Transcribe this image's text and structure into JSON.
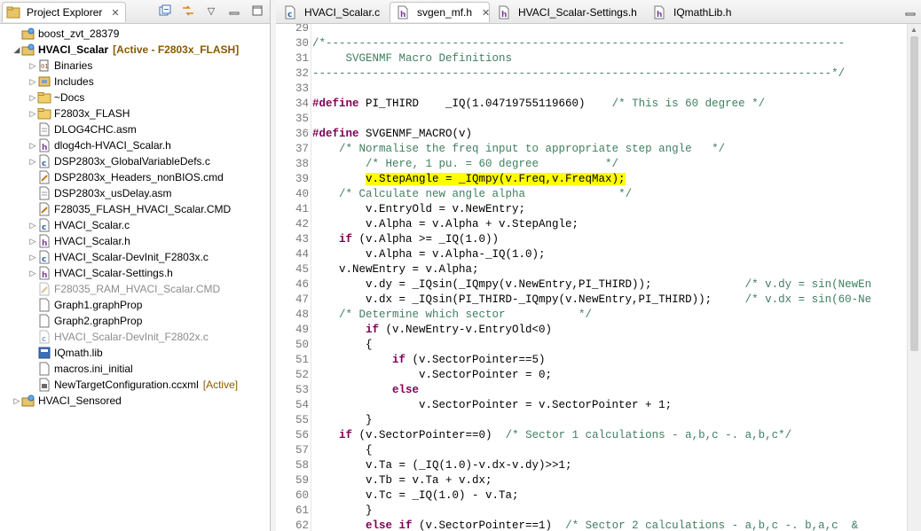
{
  "project_explorer": {
    "tab_label": "Project Explorer",
    "tools": [
      "collapse-all-icon",
      "link-editor-icon",
      "view-menu-icon",
      "minimize-icon",
      "maximize-icon"
    ],
    "items": [
      {
        "label": "boost_zvt_28379",
        "decoration": "",
        "level": 0,
        "twisty": "",
        "icon": "project-icon",
        "greyed": false,
        "bold": false
      },
      {
        "label": "HVACI_Scalar",
        "decoration": "[Active - F2803x_FLASH]",
        "level": 0,
        "twisty": "expanded",
        "icon": "project-icon",
        "greyed": false,
        "bold": true
      },
      {
        "label": "Binaries",
        "decoration": "",
        "level": 1,
        "twisty": "collapsed",
        "icon": "binaries-icon",
        "greyed": false,
        "bold": false
      },
      {
        "label": "Includes",
        "decoration": "",
        "level": 1,
        "twisty": "collapsed",
        "icon": "includes-icon",
        "greyed": false,
        "bold": false
      },
      {
        "label": "~Docs",
        "decoration": "",
        "level": 1,
        "twisty": "collapsed",
        "icon": "folder-icon",
        "greyed": false,
        "bold": false
      },
      {
        "label": "F2803x_FLASH",
        "decoration": "",
        "level": 1,
        "twisty": "collapsed",
        "icon": "folder-icon",
        "greyed": false,
        "bold": false
      },
      {
        "label": "DLOG4CHC.asm",
        "decoration": "",
        "level": 1,
        "twisty": "",
        "icon": "asm-file-icon",
        "greyed": false,
        "bold": false
      },
      {
        "label": "dlog4ch-HVACI_Scalar.h",
        "decoration": "",
        "level": 1,
        "twisty": "collapsed",
        "icon": "header-file-icon",
        "greyed": false,
        "bold": false
      },
      {
        "label": "DSP2803x_GlobalVariableDefs.c",
        "decoration": "",
        "level": 1,
        "twisty": "collapsed",
        "icon": "c-file-icon",
        "greyed": false,
        "bold": false
      },
      {
        "label": "DSP2803x_Headers_nonBIOS.cmd",
        "decoration": "",
        "level": 1,
        "twisty": "",
        "icon": "cmd-file-icon",
        "greyed": false,
        "bold": false
      },
      {
        "label": "DSP2803x_usDelay.asm",
        "decoration": "",
        "level": 1,
        "twisty": "",
        "icon": "asm-file-icon",
        "greyed": false,
        "bold": false
      },
      {
        "label": "F28035_FLASH_HVACI_Scalar.CMD",
        "decoration": "",
        "level": 1,
        "twisty": "",
        "icon": "cmd-file-icon",
        "greyed": false,
        "bold": false
      },
      {
        "label": "HVACI_Scalar.c",
        "decoration": "",
        "level": 1,
        "twisty": "collapsed",
        "icon": "c-file-icon",
        "greyed": false,
        "bold": false
      },
      {
        "label": "HVACI_Scalar.h",
        "decoration": "",
        "level": 1,
        "twisty": "collapsed",
        "icon": "header-file-icon",
        "greyed": false,
        "bold": false
      },
      {
        "label": "HVACI_Scalar-DevInit_F2803x.c",
        "decoration": "",
        "level": 1,
        "twisty": "collapsed",
        "icon": "c-file-icon",
        "greyed": false,
        "bold": false
      },
      {
        "label": "HVACI_Scalar-Settings.h",
        "decoration": "",
        "level": 1,
        "twisty": "collapsed",
        "icon": "header-file-icon",
        "greyed": false,
        "bold": false
      },
      {
        "label": "F28035_RAM_HVACI_Scalar.CMD",
        "decoration": "",
        "level": 1,
        "twisty": "",
        "icon": "cmd-file-icon",
        "greyed": true,
        "bold": false
      },
      {
        "label": "Graph1.graphProp",
        "decoration": "",
        "level": 1,
        "twisty": "",
        "icon": "file-icon",
        "greyed": false,
        "bold": false
      },
      {
        "label": "Graph2.graphProp",
        "decoration": "",
        "level": 1,
        "twisty": "",
        "icon": "file-icon",
        "greyed": false,
        "bold": false
      },
      {
        "label": "HVACI_Scalar-DevInit_F2802x.c",
        "decoration": "",
        "level": 1,
        "twisty": "",
        "icon": "c-file-icon",
        "greyed": true,
        "bold": false
      },
      {
        "label": "IQmath.lib",
        "decoration": "",
        "level": 1,
        "twisty": "",
        "icon": "library-icon",
        "greyed": false,
        "bold": false
      },
      {
        "label": "macros.ini_initial",
        "decoration": "",
        "level": 1,
        "twisty": "",
        "icon": "file-icon",
        "greyed": false,
        "bold": false
      },
      {
        "label": "NewTargetConfiguration.ccxml",
        "decoration": "[Active]",
        "level": 1,
        "twisty": "",
        "icon": "ccxml-file-icon",
        "greyed": false,
        "bold": false
      },
      {
        "label": "HVACI_Sensored",
        "decoration": "",
        "level": 0,
        "twisty": "collapsed",
        "icon": "project-icon",
        "greyed": false,
        "bold": false
      }
    ]
  },
  "editor_tabs": [
    {
      "label": "HVACI_Scalar.c",
      "icon": "c-file-icon",
      "active": false
    },
    {
      "label": "svgen_mf.h",
      "icon": "header-file-icon",
      "active": true
    },
    {
      "label": "HVACI_Scalar-Settings.h",
      "icon": "header-file-icon",
      "active": false
    },
    {
      "label": "IQmathLib.h",
      "icon": "header-file-icon",
      "active": false
    }
  ],
  "editor": {
    "lines": [
      {
        "n": "29",
        "segs": []
      },
      {
        "n": "30",
        "segs": [
          {
            "t": "/*------------------------------------------------------------------------------",
            "c": "cm"
          }
        ]
      },
      {
        "n": "31",
        "segs": [
          {
            "t": "     SVGENMF Macro Definitions",
            "c": "cm"
          }
        ]
      },
      {
        "n": "32",
        "segs": [
          {
            "t": "------------------------------------------------------------------------------*/",
            "c": "cm"
          }
        ]
      },
      {
        "n": "33",
        "segs": []
      },
      {
        "n": "34",
        "segs": [
          {
            "t": "#define",
            "c": "kw"
          },
          {
            "t": " PI_THIRD    _IQ(1.04719755119660)    ",
            "c": ""
          },
          {
            "t": "/* This is 60 degree */",
            "c": "cm"
          }
        ]
      },
      {
        "n": "35",
        "segs": []
      },
      {
        "n": "36",
        "segs": [
          {
            "t": "#define",
            "c": "kw"
          },
          {
            "t": " SVGENMF_MACRO(v)",
            "c": ""
          }
        ]
      },
      {
        "n": "37",
        "segs": [
          {
            "t": "    ",
            "c": ""
          },
          {
            "t": "/* Normalise the freq input to appropriate step angle   */",
            "c": "cm"
          }
        ]
      },
      {
        "n": "38",
        "segs": [
          {
            "t": "        ",
            "c": ""
          },
          {
            "t": "/* Here, 1 pu. = 60 degree          */",
            "c": "cm"
          }
        ]
      },
      {
        "n": "39",
        "segs": [
          {
            "t": "        ",
            "c": ""
          },
          {
            "t": "v.StepAngle = _IQmpy(v.Freq,v.FreqMax);",
            "c": "hl"
          }
        ]
      },
      {
        "n": "40",
        "segs": [
          {
            "t": "    ",
            "c": ""
          },
          {
            "t": "/* Calculate new angle alpha              */",
            "c": "cm"
          }
        ]
      },
      {
        "n": "41",
        "segs": [
          {
            "t": "        v.EntryOld = v.NewEntry;",
            "c": ""
          }
        ]
      },
      {
        "n": "42",
        "segs": [
          {
            "t": "        v.Alpha = v.Alpha + v.StepAngle;",
            "c": ""
          }
        ]
      },
      {
        "n": "43",
        "segs": [
          {
            "t": "    ",
            "c": ""
          },
          {
            "t": "if",
            "c": "kw"
          },
          {
            "t": " (v.Alpha >= _IQ(1.0))",
            "c": ""
          }
        ]
      },
      {
        "n": "44",
        "segs": [
          {
            "t": "        v.Alpha = v.Alpha-_IQ(1.0);",
            "c": ""
          }
        ]
      },
      {
        "n": "45",
        "segs": [
          {
            "t": "    v.NewEntry = v.Alpha;",
            "c": ""
          }
        ]
      },
      {
        "n": "46",
        "segs": [
          {
            "t": "        v.dy = _IQsin(_IQmpy(v.NewEntry,PI_THIRD));              ",
            "c": ""
          },
          {
            "t": "/* v.dy = sin(NewEn",
            "c": "cm"
          }
        ]
      },
      {
        "n": "47",
        "segs": [
          {
            "t": "        v.dx = _IQsin(PI_THIRD-_IQmpy(v.NewEntry,PI_THIRD));     ",
            "c": ""
          },
          {
            "t": "/* v.dx = sin(60-Ne",
            "c": "cm"
          }
        ]
      },
      {
        "n": "48",
        "segs": [
          {
            "t": "    ",
            "c": ""
          },
          {
            "t": "/* Determine which sector           */",
            "c": "cm"
          }
        ]
      },
      {
        "n": "49",
        "segs": [
          {
            "t": "        ",
            "c": ""
          },
          {
            "t": "if",
            "c": "kw"
          },
          {
            "t": " (v.NewEntry-v.EntryOld<0)",
            "c": ""
          }
        ]
      },
      {
        "n": "50",
        "segs": [
          {
            "t": "        {",
            "c": ""
          }
        ]
      },
      {
        "n": "51",
        "segs": [
          {
            "t": "            ",
            "c": ""
          },
          {
            "t": "if",
            "c": "kw"
          },
          {
            "t": " (v.SectorPointer==5)",
            "c": ""
          }
        ]
      },
      {
        "n": "52",
        "segs": [
          {
            "t": "                v.SectorPointer = 0;",
            "c": ""
          }
        ]
      },
      {
        "n": "53",
        "segs": [
          {
            "t": "            ",
            "c": ""
          },
          {
            "t": "else",
            "c": "kw"
          }
        ]
      },
      {
        "n": "54",
        "segs": [
          {
            "t": "                v.SectorPointer = v.SectorPointer + 1;",
            "c": ""
          }
        ]
      },
      {
        "n": "55",
        "segs": [
          {
            "t": "        }",
            "c": ""
          }
        ]
      },
      {
        "n": "56",
        "segs": [
          {
            "t": "    ",
            "c": ""
          },
          {
            "t": "if",
            "c": "kw"
          },
          {
            "t": " (v.SectorPointer==0)  ",
            "c": ""
          },
          {
            "t": "/* Sector 1 calculations - a,b,c -. a,b,c*/",
            "c": "cm"
          }
        ]
      },
      {
        "n": "57",
        "segs": [
          {
            "t": "        {",
            "c": ""
          }
        ]
      },
      {
        "n": "58",
        "segs": [
          {
            "t": "        v.Ta = (_IQ(1.0)-v.dx-v.dy)>>1;",
            "c": ""
          }
        ]
      },
      {
        "n": "59",
        "segs": [
          {
            "t": "        v.Tb = v.Ta + v.dx;",
            "c": ""
          }
        ]
      },
      {
        "n": "60",
        "segs": [
          {
            "t": "        v.Tc = _IQ(1.0) - v.Ta;",
            "c": ""
          }
        ]
      },
      {
        "n": "61",
        "segs": [
          {
            "t": "        }",
            "c": ""
          }
        ]
      },
      {
        "n": "62",
        "segs": [
          {
            "t": "        ",
            "c": ""
          },
          {
            "t": "else if",
            "c": "kw"
          },
          {
            "t": " (v.SectorPointer==1)  ",
            "c": ""
          },
          {
            "t": "/* Sector 2 calculations - a,b,c -. b,a,c  &",
            "c": "cm"
          }
        ]
      }
    ]
  }
}
